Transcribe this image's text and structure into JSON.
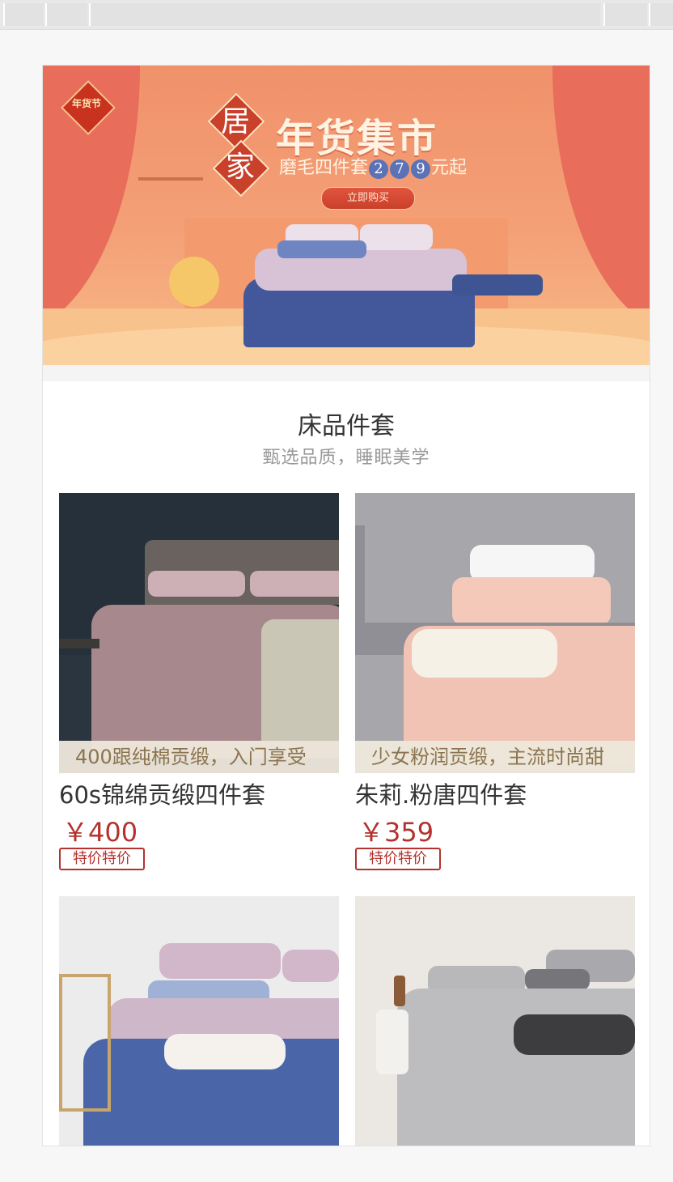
{
  "banner": {
    "badge": "年货节",
    "title_char1": "居",
    "title_char2": "家",
    "title": "年货集市",
    "subtitle_prefix": "磨毛四件套",
    "subtitle_digits": [
      "2",
      "7",
      "9"
    ],
    "subtitle_suffix": "元起",
    "cta": "立即购买",
    "colors": {
      "bg": "#f4a077",
      "curtain": "#e86d5a",
      "accent": "#c9402b"
    }
  },
  "section": {
    "title": "床品件套",
    "subtitle": "甄选品质，睡眠美学"
  },
  "products": [
    {
      "caption": "400跟纯棉贡缎，入门享受",
      "name": "60s锦绵贡缎四件套",
      "price": "￥400",
      "tag": "特价特价",
      "palette": {
        "wall": "#2b3540",
        "bed": "#a7888d",
        "throw": "#c9c6b5"
      }
    },
    {
      "caption": "少女粉润贡缎，主流时尚甜",
      "name": "朱莉.粉唐四件套",
      "price": "￥359",
      "tag": "特价特价",
      "palette": {
        "wall": "#a7a6ab",
        "bed": "#f1c3b4",
        "throw": "#f6f1e6"
      }
    },
    {
      "palette": {
        "wall": "#ececec",
        "bed": "#4a66a8",
        "throw": "#f5f2ee"
      }
    },
    {
      "palette": {
        "wall": "#ebe7e3",
        "bed": "#bdbdbf",
        "throw": "#3d3d3f"
      }
    }
  ],
  "colors": {
    "price": "#b3322e",
    "page_bg": "#f7f7f7"
  }
}
